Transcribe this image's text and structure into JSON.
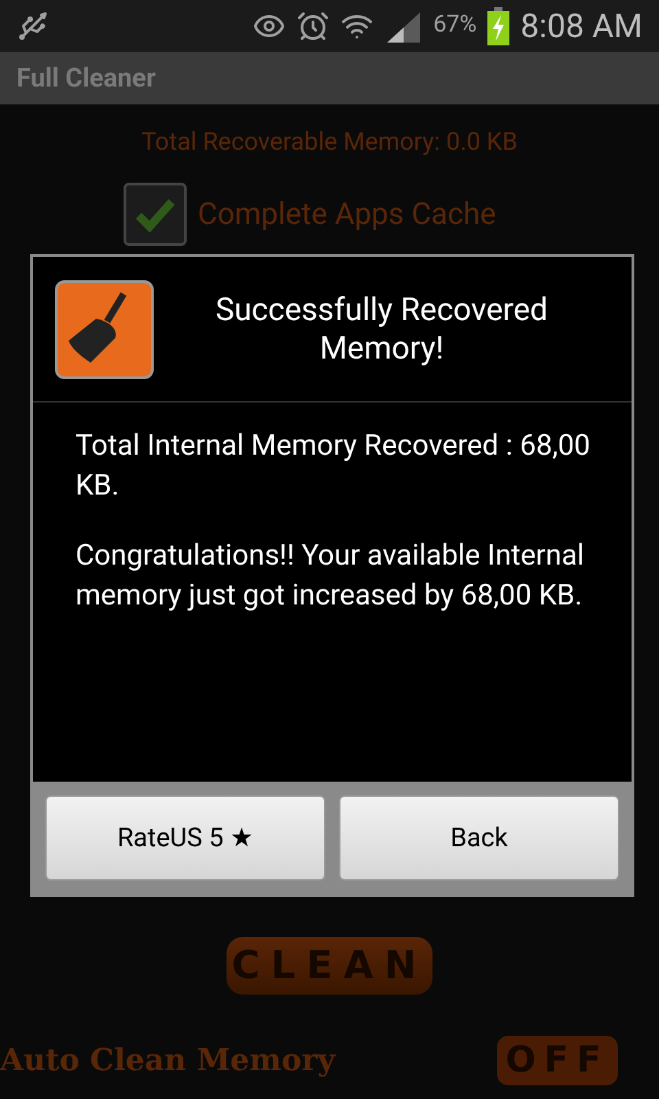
{
  "status_bar": {
    "battery": "67%",
    "time": "8:08 AM"
  },
  "app_bar": {
    "title": "Full Cleaner"
  },
  "summary": "Total Recoverable Memory: 0.0 KB",
  "options": [
    {
      "label": "Complete Apps Cache",
      "checked": true
    }
  ],
  "dialog": {
    "title": "Successfully Recovered Memory!",
    "paragraphs": [
      "Total Internal Memory Recovered : 68,00 KB.",
      "Congratulations!! Your available Internal memory just got increased by 68,00 KB."
    ],
    "buttons": [
      "RateUS 5 ★",
      "Back"
    ]
  },
  "clean_button": "CLEAN",
  "auto_clean": {
    "label": "Auto Clean Memory",
    "toggle": "OFF",
    "on": false
  }
}
